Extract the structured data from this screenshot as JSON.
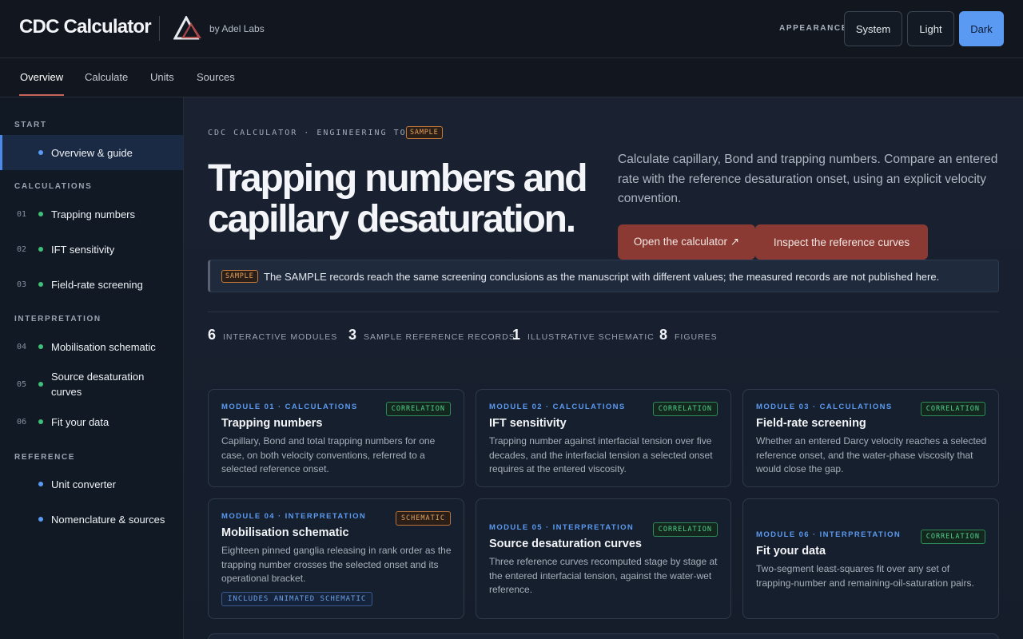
{
  "header": {
    "brand": "CDC Calculator",
    "byline": "by Adel Labs",
    "appearance_label": "APPEARANCE",
    "themes": [
      "System",
      "Light",
      "Dark"
    ],
    "active_theme": "Dark"
  },
  "tabs": [
    "Overview",
    "Calculate",
    "Units",
    "Sources"
  ],
  "active_tab": "Overview",
  "sidebar": {
    "sections": [
      {
        "heading": "START",
        "items": [
          {
            "num": "",
            "label": "Overview & guide",
            "dot": "blue",
            "active": true
          }
        ]
      },
      {
        "heading": "CALCULATIONS",
        "items": [
          {
            "num": "01",
            "label": "Trapping numbers",
            "dot": "green"
          },
          {
            "num": "02",
            "label": "IFT sensitivity",
            "dot": "green"
          },
          {
            "num": "03",
            "label": "Field-rate screening",
            "dot": "green"
          }
        ]
      },
      {
        "heading": "INTERPRETATION",
        "items": [
          {
            "num": "04",
            "label": "Mobilisation schematic",
            "dot": "green"
          },
          {
            "num": "05",
            "label": "Source desaturation curves",
            "dot": "green"
          },
          {
            "num": "06",
            "label": "Fit your data",
            "dot": "green"
          }
        ]
      },
      {
        "heading": "REFERENCE",
        "items": [
          {
            "num": "",
            "label": "Unit converter",
            "dot": "blue"
          },
          {
            "num": "",
            "label": "Nomenclature & sources",
            "dot": "blue"
          }
        ]
      }
    ]
  },
  "hero": {
    "kicker": "CDC CALCULATOR · ENGINEERING TOOL",
    "sample_badge": "SAMPLE",
    "title": "Trapping numbers and capillary desaturation.",
    "description": "Calculate capillary, Bond and trapping numbers. Compare an entered rate with the reference desaturation onset, using an explicit velocity convention.",
    "cta_primary": "Open the calculator ↗",
    "cta_secondary": "Inspect the reference curves"
  },
  "notice": {
    "badge": "SAMPLE",
    "text": "The SAMPLE records reach the same screening conclusions as the manuscript with different values; the measured records are not published here."
  },
  "stats": [
    {
      "value": "6",
      "label": "INTERACTIVE MODULES"
    },
    {
      "value": "3",
      "label": "SAMPLE REFERENCE RECORDS"
    },
    {
      "value": "1",
      "label": "ILLUSTRATIVE SCHEMATIC"
    },
    {
      "value": "8",
      "label": "FIGURES"
    }
  ],
  "cards": [
    {
      "kicker": "MODULE 01 · CALCULATIONS",
      "tag": "CORRELATION",
      "title": "Trapping numbers",
      "desc": "Capillary, Bond and total trapping numbers for one case, on both velocity conventions, referred to a selected reference onset."
    },
    {
      "kicker": "MODULE 02 · CALCULATIONS",
      "tag": "CORRELATION",
      "title": "IFT sensitivity",
      "desc": "Trapping number against interfacial tension over five decades, and the interfacial tension a selected onset requires at the entered viscosity."
    },
    {
      "kicker": "MODULE 03 · CALCULATIONS",
      "tag": "CORRELATION",
      "title": "Field-rate screening",
      "desc": "Whether an entered Darcy velocity reaches a selected reference onset, and the water-phase viscosity that would close the gap."
    },
    {
      "kicker": "MODULE 04 · INTERPRETATION",
      "tag": "SCHEMATIC",
      "title": "Mobilisation schematic",
      "desc": "Eighteen pinned ganglia releasing in rank order as the trapping number crosses the selected onset and its operational bracket.",
      "chip": "INCLUDES ANIMATED SCHEMATIC"
    },
    {
      "kicker": "MODULE 05 · INTERPRETATION",
      "tag": "CORRELATION",
      "title": "Source desaturation curves",
      "desc": "Three reference curves recomputed stage by stage at the entered interfacial tension, against the water-wet reference."
    },
    {
      "kicker": "MODULE 06 · INTERPRETATION",
      "tag": "CORRELATION",
      "title": "Fit your data",
      "desc": "Two-segment least-squares fit over any set of trapping-number and remaining-oil-saturation pairs."
    }
  ],
  "colors": {
    "accent": "#5b9af2",
    "cta": "#8a3a33",
    "correlation": "#4fd08a",
    "schematic": "#e8a15a"
  }
}
